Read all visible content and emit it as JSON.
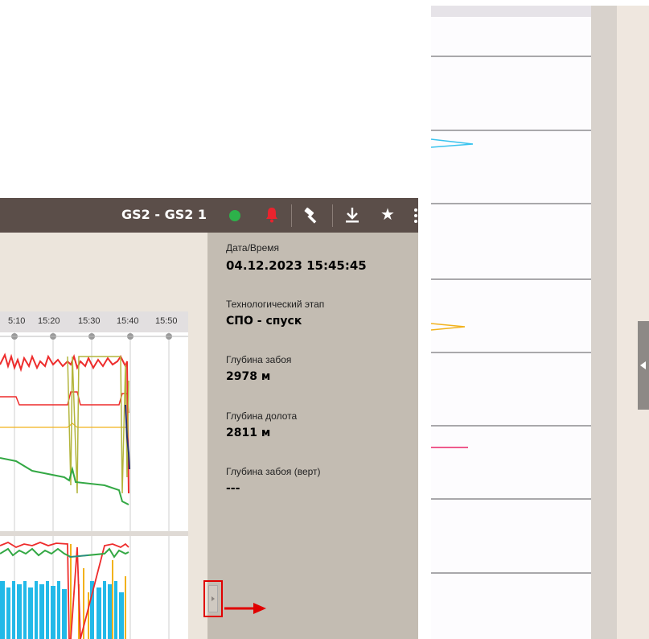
{
  "header": {
    "well_title": "GS2 - GS2 1",
    "status_color": "#2db24a",
    "alarm_color": "#e8242e",
    "icons": [
      "status-dot",
      "bell-icon",
      "hammer-icon",
      "download-icon",
      "star-icon",
      "kebab-icon"
    ]
  },
  "time_axis": {
    "ticks": [
      "5:10",
      "15:20",
      "15:30",
      "15:40",
      "15:50"
    ]
  },
  "info_panel": {
    "datetime_label": "Дата/Время",
    "datetime_value": "04.12.2023 15:45:45",
    "stage_label": "Технологический этап",
    "stage_value": "СПО - спуск",
    "hole_depth_label": "Глубина забоя",
    "hole_depth_value": "2978 м",
    "bit_depth_label": "Глубина долота",
    "bit_depth_value": "2811 м",
    "hole_depth_tvd_label": "Глубина забоя (верт)",
    "hole_depth_tvd_value": "---"
  },
  "colors": {
    "topbar": "#5b4e49",
    "info_panel": "#c3bcb2",
    "highlight": "#e00000"
  }
}
